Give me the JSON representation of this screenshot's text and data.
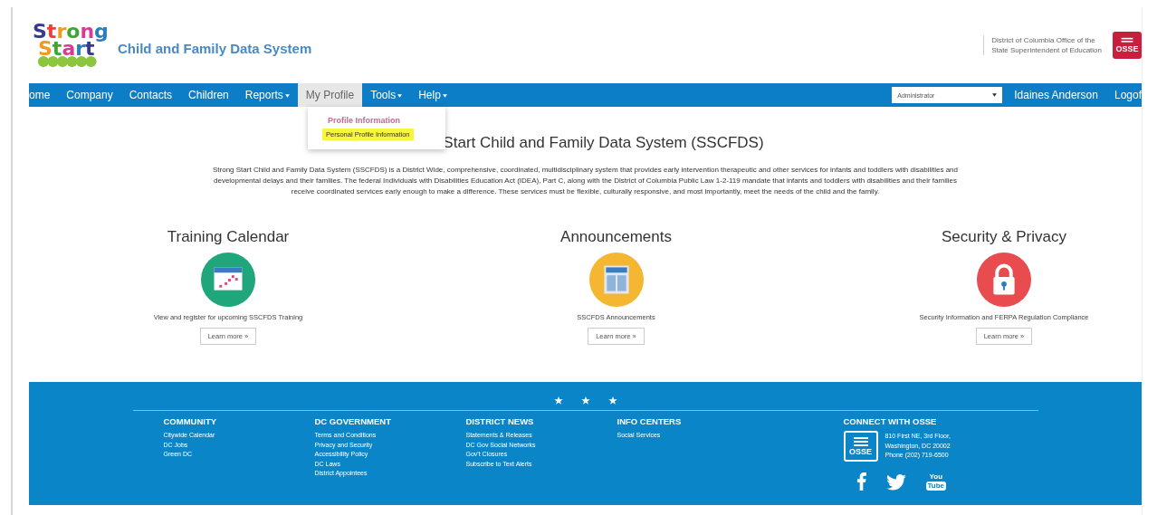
{
  "header": {
    "logo": [
      "Strong",
      "Start"
    ],
    "title": "Child and Family Data System",
    "agency": [
      "District of Columbia Office of the",
      "State Superintendent of Education"
    ],
    "agency_logo": "OSSE"
  },
  "nav": {
    "items": [
      {
        "label": "ome",
        "caret": false,
        "selected": false
      },
      {
        "label": "Company",
        "caret": false,
        "selected": false
      },
      {
        "label": "Contacts",
        "caret": false,
        "selected": false
      },
      {
        "label": "Children",
        "caret": false,
        "selected": false
      },
      {
        "label": "Reports",
        "caret": true,
        "selected": false
      },
      {
        "label": "My Profile",
        "caret": false,
        "selected": true
      },
      {
        "label": "Tools",
        "caret": true,
        "selected": false
      },
      {
        "label": "Help",
        "caret": true,
        "selected": false
      }
    ],
    "role_select": {
      "value": "Administrator"
    },
    "user": "Idaines Anderson",
    "logoff": "Logof"
  },
  "menu": {
    "items": [
      {
        "label": "Profile Information",
        "kind": "header",
        "highlighted": false
      },
      {
        "label": "Personal Profile Information",
        "kind": "link",
        "highlighted": true
      }
    ]
  },
  "heading": "Start Child and Family Data System (SSCFDS)",
  "intro": "Strong Start Child and Family Data System (SSCFDS) is a District Wide, comprehensive, coordinated, multidisciplinary system that provides early intervention therapeutic and other services for infants and toddlers with disabilities and developmental delays and their families. The federal Individuals with Disabilities Education Act (IDEA), Part C, along with the District of Columbia Public Law 1-2-119 mandate that infants and toddlers with disabilities and their families receive coordinated services early enough to make a difference. These services must be flexible, culturally responsive, and most importantly, meet the needs of the child and the family.",
  "features": [
    {
      "title": "Training Calendar",
      "kind": "calendar",
      "color": "#1fa67a",
      "description": "View and register for upcoming SSCFDS Training",
      "button": "Learn more »"
    },
    {
      "title": "Announcements",
      "kind": "news",
      "color": "#f5b731",
      "description": "SSCFDS Announcements",
      "button": "Learn more »"
    },
    {
      "title": "Security & Privacy",
      "kind": "lock",
      "color": "#e84c4f",
      "description": "Security Information and FERPA Regulation Compliance",
      "button": "Learn more »"
    }
  ],
  "footer": {
    "columns": [
      {
        "heading": "COMMUNITY",
        "links": [
          "Citywide Calendar",
          "DC Jobs",
          "Green DC"
        ]
      },
      {
        "heading": "DC GOVERNMENT",
        "links": [
          "Terms and Conditions",
          "Privacy and Security",
          "Accessibility Policy",
          "DC Laws",
          "District Appointees"
        ]
      },
      {
        "heading": "DISTRICT NEWS",
        "links": [
          "Statements & Releases",
          "DC Gov Social Networks",
          "Gov't Closures",
          "Subscribe to Text Alerts"
        ]
      },
      {
        "heading": "INFO CENTERS",
        "links": [
          "Social Services"
        ]
      }
    ],
    "connect": {
      "heading": "CONNECT WITH OSSE",
      "logo": "OSSE",
      "address": [
        "810 First NE, 3rd Floor,",
        "Washington, DC 20002",
        "Phone (202) 719-6500"
      ],
      "youtube": [
        "You",
        "Tube"
      ]
    }
  }
}
